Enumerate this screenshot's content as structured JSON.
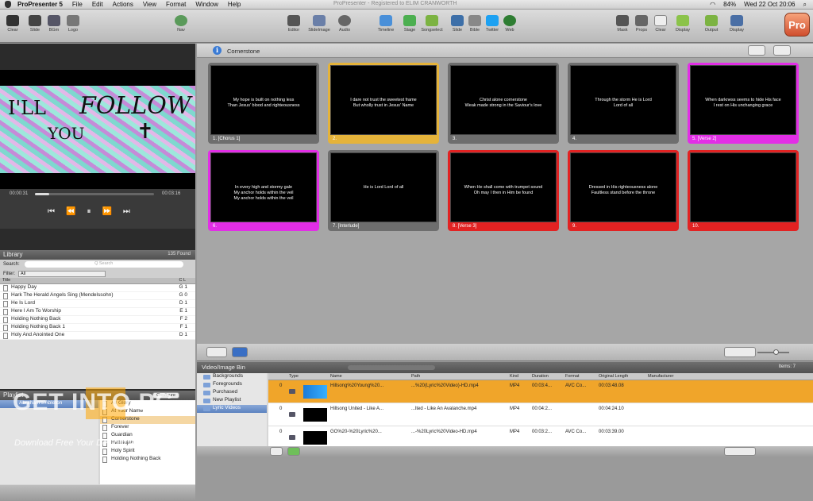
{
  "menubar": {
    "app_name": "ProPresenter 5",
    "menus": [
      "File",
      "Edit",
      "Actions",
      "View",
      "Format",
      "Window",
      "Help"
    ],
    "window_title": "ProPresenter - Registered to ELIM CRANWORTH",
    "battery": "84%",
    "clock": "Wed 22 Oct  20:06"
  },
  "toolbar": {
    "left_buttons": [
      "Clear",
      "Slide",
      "BGm",
      "Logo"
    ],
    "center_left": [
      "Nav"
    ],
    "center_buttons": [
      "Editor",
      "SlideImage",
      "Audio"
    ],
    "media_buttons": [
      "Timeline",
      "Stage",
      "Songselect",
      "Slide",
      "Bible",
      "Twitter",
      "Web"
    ],
    "right_buttons": [
      "Mask",
      "Props",
      "Clear",
      "Display",
      "Output",
      "Display"
    ],
    "logo": "Pro"
  },
  "preview": {
    "art_text": [
      "I'LL",
      "FOLLOW",
      "YOU",
      "✝"
    ],
    "elapsed": "00:00:31",
    "remaining": "00:03:16",
    "progress": 0.12
  },
  "library": {
    "title": "Library",
    "count": "135 Found",
    "search_label": "Search:",
    "search_placeholder": "Q Search",
    "filter_label": "Filter:",
    "filter_value": "All",
    "col_title": "Title",
    "col_cl": "C  L",
    "items": [
      {
        "title": "Happy Day",
        "key": "G  1"
      },
      {
        "title": "Hark The Herald Angels Sing (Mendelssohn)",
        "key": "G  0"
      },
      {
        "title": "He Is Lord",
        "key": "D  1"
      },
      {
        "title": "Here I Am To Worship",
        "key": "E  1"
      },
      {
        "title": "Holding Nothing Back",
        "key": "F  2"
      },
      {
        "title": "Holding Nothing Back 1",
        "key": "F  1"
      },
      {
        "title": "Holy And Anointed One",
        "key": "D  1"
      }
    ]
  },
  "playlist": {
    "title": "Playlist",
    "configure_label": "Configure",
    "selected_playlist": "Abraham's Ableton",
    "songs": [
      "All Glory",
      "At Your Name",
      "Cornerstone",
      "Forever",
      "Guardian",
      "Hallelujah",
      "Holy Spirit",
      "Holding Nothing Back"
    ],
    "active_song": 2
  },
  "document": {
    "title": "Cornerstone",
    "slides": [
      {
        "text": [
          "My hope is built on nothing less",
          "Than Jesus' blood and righteousness"
        ],
        "label": "1. [Chorus 1]",
        "color": "#6e6e6e",
        "selected": false
      },
      {
        "text": [
          "I dare not trust the sweetest frame",
          "But wholly trust in Jesus' Name"
        ],
        "label": "2.",
        "color": "#6e6e6e",
        "selected": true
      },
      {
        "text": [
          "Christ alone cornerstone",
          "Weak made strong in the Saviour's love"
        ],
        "label": "3.",
        "color": "#6e6e6e",
        "selected": false
      },
      {
        "text": [
          "Through the storm He is Lord",
          "Lord of all"
        ],
        "label": "4.",
        "color": "#6e6e6e",
        "selected": false
      },
      {
        "text": [
          "When darkness seems to hide His face",
          "I rest on His unchanging grace"
        ],
        "label": "5. [Verse 2]",
        "color": "#e22ee6",
        "selected": false
      },
      {
        "text": [
          "In every high and stormy gale",
          "My anchor holds within the veil",
          "My anchor holds within the veil"
        ],
        "label": "6.",
        "color": "#e22ee6",
        "selected": false
      },
      {
        "text": [
          "He is Lord Lord of all"
        ],
        "label": "7. [Interlude]",
        "color": "#6e6e6e",
        "selected": false
      },
      {
        "text": [
          "When He shall come with trumpet sound",
          "Oh may I then in Him be found"
        ],
        "label": "8. [Verse 3]",
        "color": "#e22222",
        "selected": false
      },
      {
        "text": [
          "Dressed in His righteousness alone",
          "Faultless stand before the throne"
        ],
        "label": "9.",
        "color": "#e22222",
        "selected": false
      },
      {
        "text": [],
        "label": "10.",
        "color": "#e22222",
        "selected": false
      }
    ]
  },
  "bin": {
    "title": "Video/Image Bin",
    "items_count": "Items: 7",
    "folders": [
      "Backgrounds",
      "Foregrounds",
      "Purchased",
      "New Playlist",
      "Lyric Videos"
    ],
    "selected_folder": 4,
    "columns": [
      "Type",
      "Name",
      "Path",
      "Kind",
      "Duration",
      "Format",
      "Original Length",
      "Manufacturer"
    ],
    "rows": [
      {
        "num": "0",
        "name": "Hillsong%20Young%20...",
        "path": "...%20(Lyric%20Video)-HD.mp4",
        "kind": "MP4",
        "duration": "00:03:4...",
        "format": "AVC Co...",
        "length": "00:03:48.08",
        "selected": true
      },
      {
        "num": "0",
        "name": "Hillsong United - Like A...",
        "path": "...lted - Like An Avalanche.mp4",
        "kind": "MP4",
        "duration": "00:04:2...",
        "format": "",
        "length": "00:04:24.10",
        "selected": false
      },
      {
        "num": "0",
        "name": "GO%20-%20Lyric%20...",
        "path": "...-%20Lyric%20Video-HD.mp4",
        "kind": "MP4",
        "duration": "00:03:2...",
        "format": "AVC Co...",
        "length": "00:03:39.00",
        "selected": false
      }
    ]
  },
  "watermark": {
    "main": "GET INTO PC",
    "sub": "Download Free Your Desired App"
  },
  "colors": {
    "selection": "#e5b33a",
    "verse2": "#e22ee6",
    "verse3": "#e22222",
    "bin_selected": "#f0a52a"
  }
}
